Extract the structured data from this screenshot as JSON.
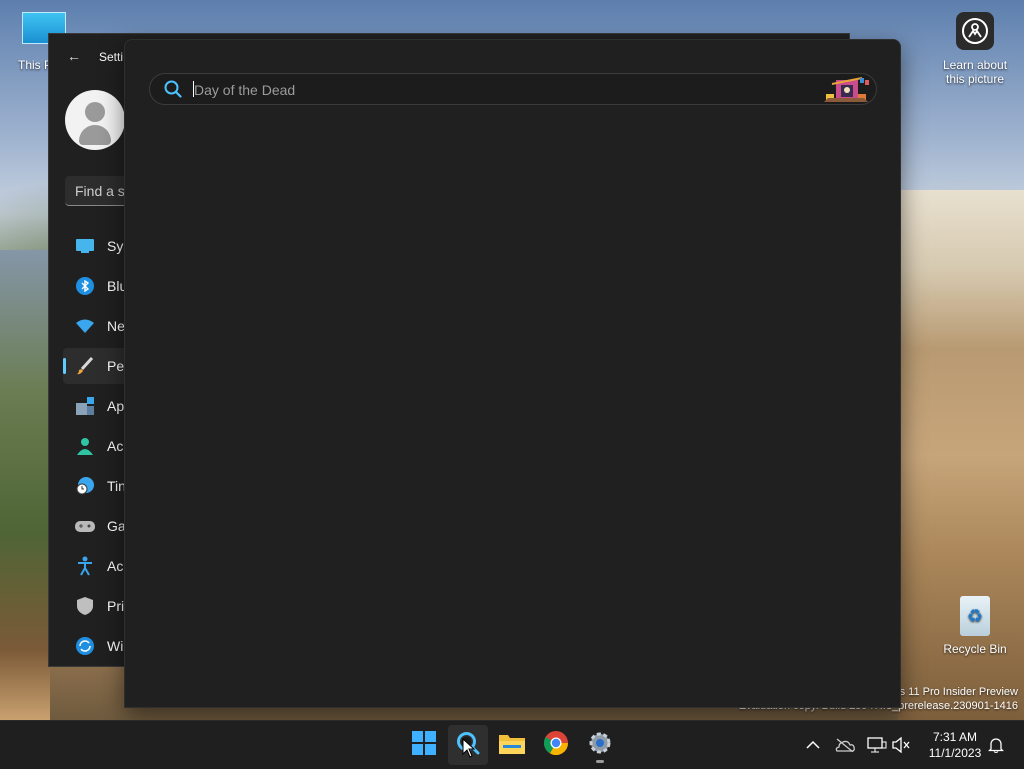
{
  "desktop": {
    "this_pc_label": "This P",
    "learn_label_line1": "Learn about",
    "learn_label_line2": "this picture",
    "recycle_label": "Recycle Bin",
    "watermark_line1": "s 11 Pro Insider Preview",
    "watermark_line2": "Evaluation copy. Build 25947.rs_prerelease.230901-1416"
  },
  "settings": {
    "title": "Setti",
    "find_placeholder": "Find a se",
    "nav": [
      {
        "label": "Sys",
        "icon": "system-icon"
      },
      {
        "label": "Blu",
        "icon": "bluetooth-icon"
      },
      {
        "label": "Ne",
        "icon": "network-icon"
      },
      {
        "label": "Pe",
        "icon": "personalization-icon",
        "active": true
      },
      {
        "label": "Ap",
        "icon": "apps-icon"
      },
      {
        "label": "Ac",
        "icon": "accounts-icon"
      },
      {
        "label": "Tin",
        "icon": "time-language-icon"
      },
      {
        "label": "Ga",
        "icon": "gaming-icon"
      },
      {
        "label": "Ac",
        "icon": "accessibility-icon"
      },
      {
        "label": "Pri",
        "icon": "privacy-icon"
      },
      {
        "label": "Wi",
        "icon": "windows-update-icon"
      }
    ]
  },
  "search_panel": {
    "placeholder": "Day of the Dead",
    "highlight_icon": "day-of-the-dead-highlight-icon"
  },
  "taskbar": {
    "apps": [
      "start-icon",
      "search-icon",
      "file-explorer-icon",
      "chrome-icon",
      "settings-icon"
    ],
    "time": "7:31 AM",
    "date": "11/1/2023"
  },
  "colors": {
    "accent": "#60cdff",
    "panel_bg": "#202020",
    "taskbar_bg": "#1f1f1f"
  }
}
